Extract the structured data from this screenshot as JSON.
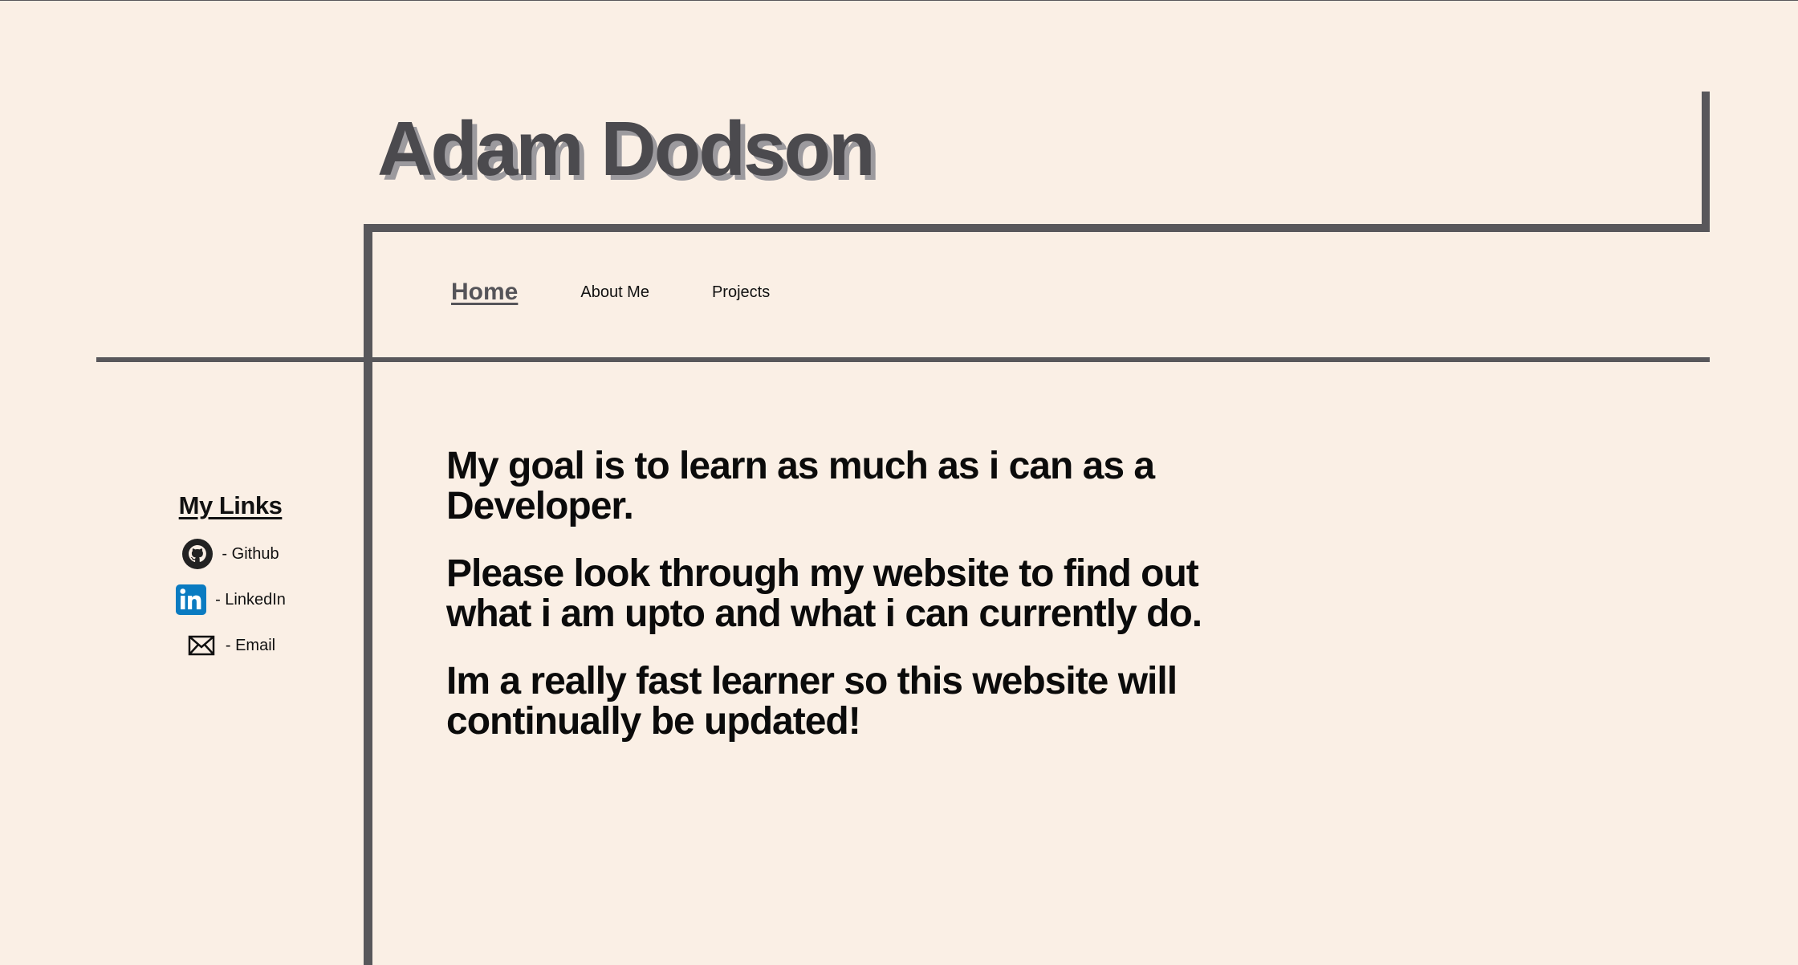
{
  "colors": {
    "background": "#faefe5",
    "rule": "#58575b",
    "title": "#4b4a4e",
    "title_shadow": "#9c9a9e",
    "linkedin_brand": "#0a7bc1"
  },
  "header": {
    "title": "Adam Dodson"
  },
  "nav": {
    "items": [
      {
        "label": "Home",
        "active": true
      },
      {
        "label": "About Me",
        "active": false
      },
      {
        "label": "Projects",
        "active": false
      }
    ]
  },
  "sidebar": {
    "heading": "My Links",
    "links": [
      {
        "label": "- Github",
        "icon": "github-icon"
      },
      {
        "label": "- LinkedIn",
        "icon": "linkedin-icon"
      },
      {
        "label": "- Email",
        "icon": "email-icon"
      }
    ]
  },
  "main": {
    "paragraphs": [
      "My goal is to learn as much as i can as a Developer.",
      "Please look through my website to find out what i am upto and what i can currently do.",
      "Im a really fast learner so this website will continually be updated!"
    ]
  }
}
